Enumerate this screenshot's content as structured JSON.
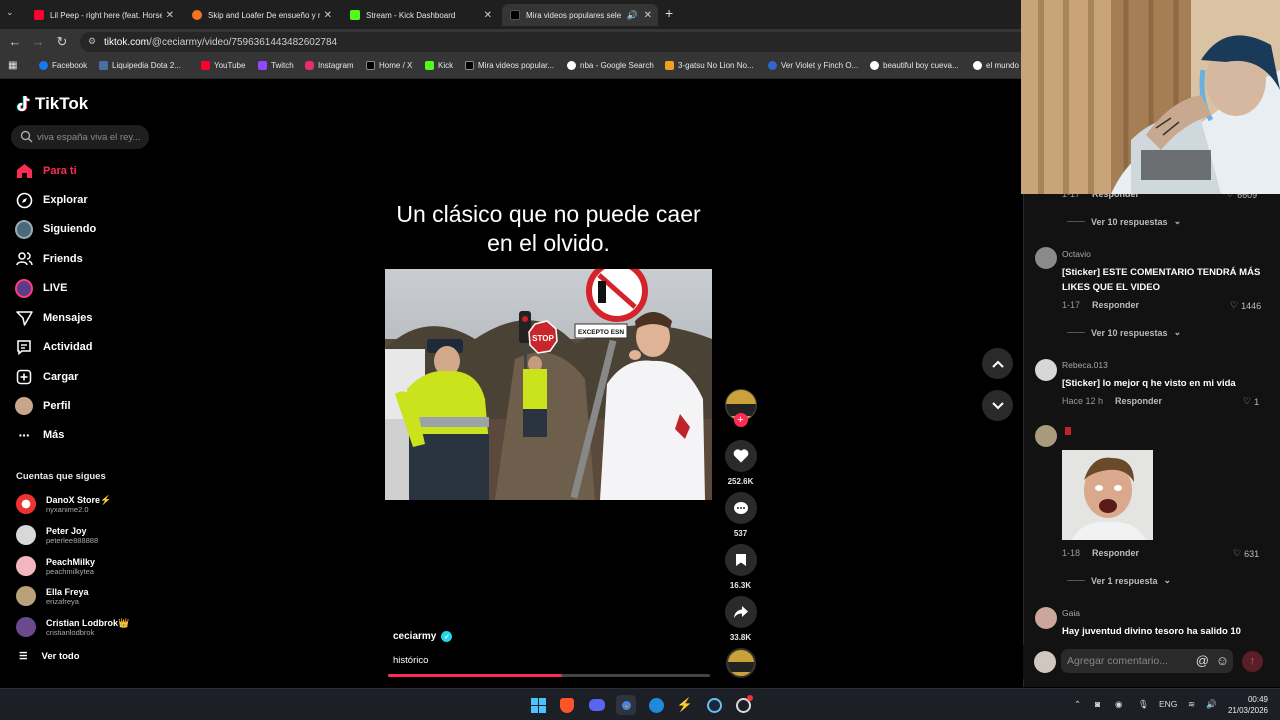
{
  "browser": {
    "tabs": [
      {
        "label": "Lil Peep - right here (feat. Horse",
        "color": "#ff0033",
        "active": false
      },
      {
        "label": "Skip and Loafer De ensueño y r",
        "color": "#f47521",
        "active": false
      },
      {
        "label": "Stream - Kick Dashboard",
        "color": "#53fc18",
        "active": false
      },
      {
        "label": "Mira videos populares sele",
        "color": "#000000",
        "active": true
      }
    ],
    "new_tab": "+",
    "url_domain": "tiktok.com",
    "url_path": "/@ceciarmy/video/7596361443482602784",
    "bookmarks": [
      {
        "label": "Facebook",
        "color": "#1877f2"
      },
      {
        "label": "Liquipedia Dota 2...",
        "color": "#4a6fa5"
      },
      {
        "label": "YouTube",
        "color": "#ff0033"
      },
      {
        "label": "Twitch",
        "color": "#9146ff"
      },
      {
        "label": "Instagram",
        "color": "#e1306c"
      },
      {
        "label": "Home / X",
        "color": "#000000"
      },
      {
        "label": "Kick",
        "color": "#53fc18"
      },
      {
        "label": "Mira videos popular...",
        "color": "#000000"
      },
      {
        "label": "nba - Google Search",
        "color": "#ffffff"
      },
      {
        "label": "3-gatsu No Lion No...",
        "color": "#f0a020"
      },
      {
        "label": "Ver Violet y Finch O...",
        "color": "#3366cc"
      },
      {
        "label": "beautiful boy cueva...",
        "color": "#ffffff"
      },
      {
        "label": "el mundo",
        "color": "#ffffff"
      }
    ]
  },
  "sidebar": {
    "logo": "TikTok",
    "search_placeholder": "viva españa viva el rey...",
    "nav": [
      {
        "label": "Para ti",
        "icon": "home-icon",
        "active": true
      },
      {
        "label": "Explorar",
        "icon": "compass-icon",
        "active": false
      },
      {
        "label": "Siguiendo",
        "icon": "following-icon",
        "active": false
      },
      {
        "label": "Friends",
        "icon": "friends-icon",
        "active": false
      },
      {
        "label": "LIVE",
        "icon": "live-icon",
        "active": false
      },
      {
        "label": "Mensajes",
        "icon": "send-icon",
        "active": false
      },
      {
        "label": "Actividad",
        "icon": "activity-icon",
        "active": false
      },
      {
        "label": "Cargar",
        "icon": "upload-icon",
        "active": false
      },
      {
        "label": "Perfil",
        "icon": "profile-icon",
        "active": false
      },
      {
        "label": "Más",
        "icon": "more-icon",
        "active": false
      }
    ],
    "following_title": "Cuentas que sigues",
    "following": [
      {
        "name": "DanoX Store⚡",
        "handle": "nyxanime2.0",
        "color": "#e35"
      },
      {
        "name": "Peter Joy",
        "handle": "peterlee888888",
        "color": "#ccc"
      },
      {
        "name": "PeachMilky",
        "handle": "peachmilkytea",
        "color": "#f3b6c0"
      },
      {
        "name": "Ella Freya",
        "handle": "erizafreya",
        "color": "#b9a27a"
      },
      {
        "name": "Cristian Lodbrok👑",
        "handle": "cristianlodbrok",
        "color": "#6a4a8a"
      }
    ],
    "see_all": "Ver todo"
  },
  "video": {
    "overlay_text": "Un clásico que no puede caer en el olvido.",
    "author": "ceciarmy",
    "description": "histórico",
    "progress": 0.54,
    "stop_sign": "STOP",
    "sign_text": "EXCEPTO ESN"
  },
  "actions": {
    "likes": "252.6K",
    "comments": "537",
    "saves": "16.3K",
    "shares": "33.8K"
  },
  "comments": {
    "top_partial": {
      "meta": "1-17",
      "reply": "Responder",
      "likes": "6609"
    },
    "items": [
      {
        "user": "Octavio",
        "text": "[Sticker] ESTE COMENTARIO TENDRÁ MÁS LIKES QUE EL VIDEO",
        "date": "1-17",
        "reply": "Responder",
        "likes": "1446"
      },
      {
        "user": "Rebeca.013",
        "text": "[Sticker] lo mejor q he visto en mi vida",
        "date": "Hace 12 h",
        "reply": "Responder",
        "likes": "1"
      },
      {
        "user": "",
        "text": "",
        "date": "1-18",
        "reply": "Responder",
        "likes": "631"
      },
      {
        "user": "Gaia",
        "text": "Hay juventud divino tesoro ha salido 10"
      }
    ],
    "more_replies_1": "Ver 10 respuestas",
    "more_replies_2": "Ver 10 respuestas",
    "more_replies_3": "Ver 1 respuesta",
    "input_placeholder": "Agregar comentario..."
  },
  "taskbar": {
    "lang": "ENG",
    "time": "00:49",
    "date": "21/03/2026"
  }
}
